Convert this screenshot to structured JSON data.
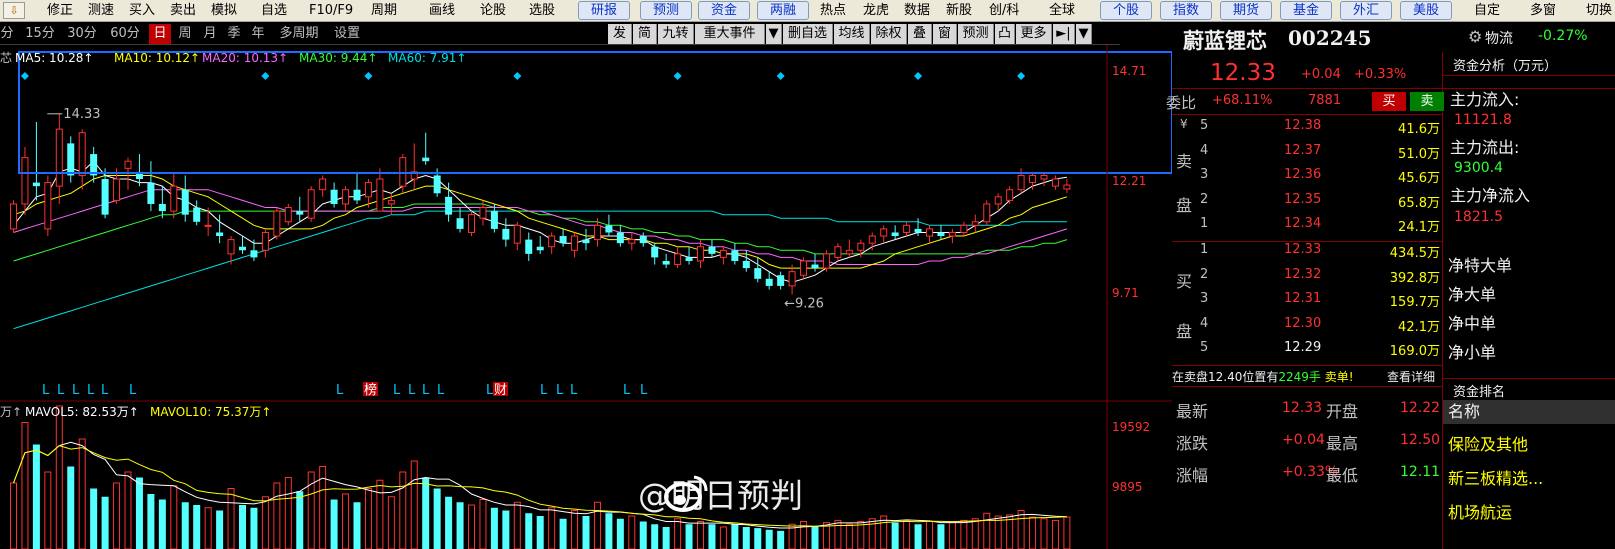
{
  "topbar": {
    "items": [
      "修正",
      "测速",
      "买入",
      "卖出",
      "模拟",
      "自选",
      "F10/F9",
      "周期",
      "画线",
      "论股",
      "选股"
    ],
    "buttons": [
      "研报",
      "预测",
      "资金",
      "两融"
    ],
    "items2": [
      "热点",
      "龙虎",
      "数据",
      "新股",
      "创/科",
      "全球"
    ],
    "buttons2": [
      "个股",
      "指数",
      "期货",
      "基金",
      "外汇",
      "美股"
    ],
    "items3": [
      "自定",
      "多窗",
      "切换"
    ]
  },
  "periods": [
    "分",
    "15分",
    "30分",
    "60分",
    "日",
    "周",
    "月",
    "季",
    "年",
    "多周期",
    "设置"
  ],
  "active_period": "日",
  "toolbar_right": [
    "发",
    "简",
    "九转",
    "重大事件",
    "▼",
    "删自选",
    "均线",
    "除权",
    "叠",
    "窗",
    "预测",
    "凸",
    "更多",
    "►|",
    "▼"
  ],
  "ma_labels": {
    "prefix": "芯",
    "ma5": "MA5: 10.28↑",
    "ma10": "MA10: 10.12↑",
    "ma20": "MA20: 10.13↑",
    "ma30": "MA30: 9.44↑",
    "ma60": "MA60: 7.91↑"
  },
  "vol_labels": {
    "prefix": "万↑",
    "mavol5": "MAVOL5: 82.53万↑",
    "mavol10": "MAVOL10: 75.37万↑"
  },
  "price_axis": [
    "14.71",
    "12.21",
    "9.71"
  ],
  "vol_axis": [
    "19592",
    "9895"
  ],
  "annotations": {
    "high": "14.33",
    "low": "←9.26"
  },
  "signal_row": [
    "L",
    "L",
    "L",
    "L",
    "L",
    "L",
    "L",
    "榜",
    "L",
    "L",
    "L",
    "L",
    "L",
    "财",
    "L",
    "L",
    "L",
    "L",
    "L"
  ],
  "watermark": "@明日预判",
  "colors": {
    "up": "#ff3030",
    "down": "#54ffff",
    "ma5": "#ffffff",
    "ma10": "#ffff00",
    "ma20": "#ff66ff",
    "ma30": "#33ff33",
    "ma60": "#00e0e0",
    "box": "#1e6cff"
  },
  "chart_data": {
    "type": "candlestick",
    "ylim": [
      7.0,
      15.7
    ],
    "ohlc": [
      [
        11.1,
        11.9,
        11.0,
        11.8
      ],
      [
        11.8,
        13.4,
        11.5,
        13.1
      ],
      [
        12.4,
        14.1,
        11.9,
        12.3
      ],
      [
        11.1,
        12.6,
        10.9,
        12.4
      ],
      [
        12.3,
        14.33,
        11.8,
        13.9
      ],
      [
        13.5,
        13.7,
        12.4,
        12.6
      ],
      [
        12.6,
        13.9,
        12.2,
        13.8
      ],
      [
        13.2,
        13.4,
        12.4,
        12.6
      ],
      [
        12.5,
        12.8,
        11.4,
        11.5
      ],
      [
        11.9,
        12.8,
        11.8,
        12.5
      ],
      [
        12.8,
        13.1,
        12.2,
        13.0
      ],
      [
        12.7,
        13.2,
        12.3,
        12.5
      ],
      [
        12.4,
        13.0,
        11.6,
        11.8
      ],
      [
        11.8,
        12.3,
        11.4,
        11.6
      ],
      [
        11.6,
        12.7,
        11.4,
        12.3
      ],
      [
        12.2,
        12.6,
        11.3,
        11.5
      ],
      [
        11.7,
        11.9,
        11.2,
        11.3
      ],
      [
        11.2,
        11.7,
        10.9,
        11.2
      ],
      [
        11.0,
        11.5,
        10.7,
        10.9
      ],
      [
        10.4,
        10.9,
        10.1,
        10.8
      ],
      [
        10.6,
        10.9,
        10.4,
        10.5
      ],
      [
        10.5,
        10.8,
        10.2,
        10.3
      ],
      [
        10.5,
        11.1,
        10.3,
        11.0
      ],
      [
        10.9,
        11.7,
        10.8,
        11.6
      ],
      [
        11.3,
        11.8,
        11.2,
        11.7
      ],
      [
        11.6,
        12.0,
        11.3,
        11.5
      ],
      [
        11.4,
        12.3,
        11.3,
        12.2
      ],
      [
        12.2,
        12.6,
        12.0,
        12.5
      ],
      [
        12.2,
        12.4,
        11.7,
        11.8
      ],
      [
        11.8,
        12.3,
        11.6,
        12.2
      ],
      [
        12.2,
        12.7,
        11.8,
        11.9
      ],
      [
        12.0,
        12.5,
        11.7,
        12.4
      ],
      [
        11.6,
        12.8,
        11.6,
        12.5
      ],
      [
        11.8,
        12.1,
        11.5,
        11.9
      ],
      [
        12.3,
        13.2,
        12.1,
        13.1
      ],
      [
        12.5,
        13.5,
        12.2,
        12.7
      ],
      [
        13.1,
        13.8,
        12.9,
        13.0
      ],
      [
        12.6,
        12.8,
        12.0,
        12.1
      ],
      [
        12.0,
        12.4,
        11.3,
        11.5
      ],
      [
        11.4,
        11.7,
        11.0,
        11.1
      ],
      [
        11.0,
        11.6,
        10.9,
        11.5
      ],
      [
        11.4,
        11.9,
        11.2,
        11.7
      ],
      [
        11.6,
        11.8,
        11.0,
        11.1
      ],
      [
        11.1,
        11.4,
        10.6,
        10.8
      ],
      [
        10.7,
        11.3,
        10.5,
        11.2
      ],
      [
        10.8,
        11.0,
        10.2,
        10.4
      ],
      [
        10.6,
        10.9,
        10.4,
        10.5
      ],
      [
        10.6,
        11.0,
        10.4,
        10.9
      ],
      [
        10.9,
        11.1,
        10.6,
        10.7
      ],
      [
        10.5,
        11.0,
        10.3,
        10.9
      ],
      [
        10.8,
        11.1,
        10.5,
        10.7
      ],
      [
        10.8,
        11.4,
        10.6,
        11.2
      ],
      [
        11.2,
        11.5,
        10.9,
        11.0
      ],
      [
        11.0,
        11.2,
        10.6,
        10.7
      ],
      [
        10.7,
        11.0,
        10.5,
        10.8
      ],
      [
        10.9,
        11.0,
        10.6,
        10.7
      ],
      [
        10.6,
        10.7,
        10.1,
        10.3
      ],
      [
        10.2,
        10.4,
        10.0,
        10.1
      ],
      [
        10.1,
        10.6,
        10.0,
        10.4
      ],
      [
        10.3,
        10.6,
        10.1,
        10.2
      ],
      [
        10.2,
        10.8,
        10.0,
        10.6
      ],
      [
        10.6,
        10.8,
        10.3,
        10.4
      ],
      [
        10.3,
        10.6,
        10.1,
        10.5
      ],
      [
        10.5,
        10.7,
        10.1,
        10.2
      ],
      [
        10.2,
        10.5,
        9.9,
        10.0
      ],
      [
        10.0,
        10.3,
        9.6,
        9.7
      ],
      [
        9.7,
        9.9,
        9.4,
        9.5
      ],
      [
        9.8,
        9.9,
        9.4,
        9.5
      ],
      [
        9.5,
        10.1,
        9.26,
        9.9
      ],
      [
        9.8,
        10.3,
        9.7,
        10.2
      ],
      [
        10.1,
        10.4,
        9.9,
        10.0
      ],
      [
        10.0,
        10.5,
        9.9,
        10.4
      ],
      [
        10.3,
        10.7,
        10.2,
        10.6
      ],
      [
        10.4,
        10.8,
        10.3,
        10.5
      ],
      [
        10.5,
        10.8,
        10.3,
        10.7
      ],
      [
        10.7,
        11.0,
        10.5,
        10.9
      ],
      [
        10.9,
        11.2,
        10.7,
        11.1
      ],
      [
        11.0,
        11.2,
        10.8,
        10.9
      ],
      [
        11.0,
        11.3,
        10.9,
        11.2
      ],
      [
        11.1,
        11.4,
        10.9,
        11.0
      ],
      [
        10.9,
        11.2,
        10.7,
        11.1
      ],
      [
        11.0,
        11.2,
        10.8,
        10.9
      ],
      [
        10.9,
        11.1,
        10.7,
        11.0
      ],
      [
        11.0,
        11.3,
        10.9,
        11.2
      ],
      [
        11.2,
        11.5,
        11.0,
        11.3
      ],
      [
        11.3,
        11.9,
        11.2,
        11.8
      ],
      [
        11.8,
        12.1,
        11.6,
        12.0
      ],
      [
        11.9,
        12.3,
        11.8,
        12.2
      ],
      [
        12.2,
        12.8,
        12.1,
        12.6
      ],
      [
        12.4,
        12.7,
        12.2,
        12.6
      ],
      [
        12.5,
        12.7,
        12.3,
        12.6
      ],
      [
        12.3,
        12.6,
        12.2,
        12.5
      ],
      [
        12.22,
        12.5,
        12.11,
        12.33
      ]
    ],
    "ma": {
      "ma5": [
        11.2,
        11.6,
        12.0,
        12.1,
        12.7,
        12.8,
        12.7,
        13.0,
        12.6,
        12.5,
        12.5,
        12.4,
        12.4,
        12.3,
        12.0,
        11.9,
        11.7,
        11.6,
        11.3,
        11.1,
        10.9,
        10.7,
        10.7,
        10.9,
        11.1,
        11.3,
        11.5,
        11.8,
        11.9,
        12.0,
        12.0,
        12.1,
        12.2,
        12.1,
        12.3,
        12.5,
        12.6,
        12.5,
        12.2,
        11.9,
        11.6,
        11.4,
        11.3,
        11.2,
        11.2,
        11.1,
        11.0,
        10.8,
        10.7,
        10.7,
        10.8,
        10.9,
        10.9,
        10.9,
        10.8,
        10.8,
        10.6,
        10.5,
        10.4,
        10.3,
        10.3,
        10.3,
        10.4,
        10.4,
        10.3,
        10.1,
        9.9,
        9.7,
        9.6,
        9.7,
        9.8,
        10.0,
        10.2,
        10.3,
        10.4,
        10.6,
        10.7,
        10.8,
        10.9,
        11.0,
        11.0,
        11.0,
        11.0,
        11.0,
        11.2,
        11.4,
        11.6,
        11.9,
        12.1,
        12.3,
        12.4,
        12.5,
        12.55
      ],
      "ma10": [
        11.5,
        11.6,
        11.8,
        11.9,
        12.0,
        12.1,
        12.3,
        12.5,
        12.6,
        12.6,
        12.6,
        12.6,
        12.6,
        12.5,
        12.3,
        12.2,
        12.1,
        12.0,
        11.8,
        11.6,
        11.4,
        11.2,
        11.1,
        11.1,
        11.1,
        11.1,
        11.1,
        11.2,
        11.4,
        11.5,
        11.7,
        11.8,
        11.9,
        12.0,
        12.1,
        12.2,
        12.3,
        12.3,
        12.2,
        12.1,
        12.0,
        11.9,
        11.8,
        11.7,
        11.6,
        11.4,
        11.3,
        11.2,
        11.1,
        11.0,
        10.9,
        10.9,
        10.8,
        10.8,
        10.8,
        10.8,
        10.7,
        10.7,
        10.6,
        10.6,
        10.5,
        10.5,
        10.4,
        10.4,
        10.4,
        10.3,
        10.1,
        10.0,
        10.0,
        10.0,
        10.0,
        10.0,
        10.0,
        10.0,
        10.0,
        10.1,
        10.2,
        10.4,
        10.5,
        10.6,
        10.7,
        10.8,
        10.9,
        10.9,
        11.0,
        11.1,
        11.2,
        11.4,
        11.5,
        11.7,
        11.8,
        11.9,
        12.0
      ],
      "ma20": [
        11.0,
        11.1,
        11.2,
        11.3,
        11.4,
        11.5,
        11.6,
        11.7,
        11.8,
        11.9,
        12.0,
        12.1,
        12.2,
        12.2,
        12.2,
        12.2,
        12.2,
        12.2,
        12.1,
        12.0,
        11.9,
        11.8,
        11.7,
        11.7,
        11.6,
        11.6,
        11.6,
        11.6,
        11.6,
        11.6,
        11.6,
        11.6,
        11.6,
        11.6,
        11.6,
        11.7,
        11.7,
        11.7,
        11.7,
        11.7,
        11.7,
        11.7,
        11.7,
        11.7,
        11.7,
        11.6,
        11.6,
        11.5,
        11.4,
        11.3,
        11.2,
        11.2,
        11.1,
        11.0,
        11.0,
        10.9,
        10.9,
        10.8,
        10.8,
        10.7,
        10.7,
        10.6,
        10.6,
        10.5,
        10.5,
        10.4,
        10.4,
        10.3,
        10.3,
        10.2,
        10.2,
        10.2,
        10.1,
        10.1,
        10.1,
        10.1,
        10.1,
        10.1,
        10.1,
        10.1,
        10.2,
        10.2,
        10.3,
        10.3,
        10.4,
        10.4,
        10.5,
        10.6,
        10.7,
        10.8,
        10.9,
        11.0,
        11.1
      ],
      "ma30": [
        10.2,
        10.3,
        10.4,
        10.5,
        10.6,
        10.7,
        10.8,
        10.9,
        11.0,
        11.1,
        11.2,
        11.3,
        11.4,
        11.5,
        11.5,
        11.6,
        11.6,
        11.6,
        11.6,
        11.6,
        11.6,
        11.6,
        11.6,
        11.6,
        11.6,
        11.6,
        11.6,
        11.6,
        11.6,
        11.6,
        11.6,
        11.6,
        11.7,
        11.7,
        11.7,
        11.8,
        11.8,
        11.8,
        11.8,
        11.8,
        11.8,
        11.8,
        11.7,
        11.7,
        11.6,
        11.6,
        11.5,
        11.5,
        11.4,
        11.4,
        11.3,
        11.3,
        11.2,
        11.2,
        11.1,
        11.1,
        11.0,
        11.0,
        10.9,
        10.9,
        10.8,
        10.8,
        10.8,
        10.7,
        10.7,
        10.6,
        10.6,
        10.5,
        10.5,
        10.5,
        10.4,
        10.4,
        10.4,
        10.4,
        10.4,
        10.4,
        10.4,
        10.4,
        10.4,
        10.4,
        10.4,
        10.4,
        10.4,
        10.4,
        10.4,
        10.5,
        10.5,
        10.5,
        10.6,
        10.6,
        10.7,
        10.7,
        10.8
      ],
      "ma60": [
        8.3,
        8.4,
        8.5,
        8.6,
        8.7,
        8.8,
        8.9,
        9.0,
        9.1,
        9.2,
        9.3,
        9.4,
        9.5,
        9.6,
        9.7,
        9.8,
        9.9,
        10.0,
        10.1,
        10.2,
        10.3,
        10.4,
        10.5,
        10.6,
        10.7,
        10.8,
        10.9,
        11.0,
        11.1,
        11.2,
        11.3,
        11.4,
        11.4,
        11.5,
        11.5,
        11.5,
        11.6,
        11.6,
        11.6,
        11.6,
        11.6,
        11.6,
        11.6,
        11.6,
        11.6,
        11.6,
        11.6,
        11.6,
        11.6,
        11.6,
        11.6,
        11.6,
        11.6,
        11.6,
        11.6,
        11.6,
        11.6,
        11.6,
        11.6,
        11.6,
        11.6,
        11.6,
        11.5,
        11.5,
        11.5,
        11.5,
        11.5,
        11.4,
        11.4,
        11.4,
        11.4,
        11.4,
        11.3,
        11.3,
        11.3,
        11.3,
        11.3,
        11.3,
        11.3,
        11.3,
        11.2,
        11.2,
        11.2,
        11.2,
        11.2,
        11.2,
        11.2,
        11.2,
        11.3,
        11.3,
        11.3,
        11.3,
        11.3
      ]
    },
    "volume": [
      120,
      230,
      190,
      140,
      260,
      150,
      200,
      110,
      95,
      120,
      140,
      130,
      100,
      90,
      115,
      85,
      80,
      75,
      70,
      110,
      80,
      75,
      95,
      120,
      130,
      105,
      140,
      150,
      90,
      100,
      85,
      110,
      125,
      95,
      140,
      160,
      130,
      110,
      95,
      85,
      80,
      90,
      75,
      70,
      85,
      65,
      60,
      75,
      55,
      70,
      60,
      85,
      65,
      55,
      60,
      50,
      45,
      40,
      55,
      45,
      50,
      45,
      40,
      45,
      40,
      38,
      35,
      33,
      45,
      50,
      42,
      48,
      52,
      45,
      50,
      55,
      60,
      48,
      52,
      45,
      50,
      45,
      48,
      52,
      55,
      65,
      60,
      62,
      70,
      58,
      55,
      52,
      58
    ],
    "volume_axis_max": 19592
  },
  "stock": {
    "name": "蔚蓝锂芯",
    "code": "002245",
    "price": "12.33",
    "change": "+0.04",
    "pct": "+0.33%",
    "gear": "⚙",
    "sector": "物流",
    "sector_pct": "-0.27%"
  },
  "weibi": {
    "label": "委比",
    "value": "+68.11%",
    "diff": "7881",
    "buy_btn": "买",
    "sell_btn": "卖"
  },
  "sell_side": {
    "label1": "¥",
    "label2": "卖",
    "label3": "盘",
    "rows": [
      [
        "5",
        "12.38",
        "41.6万"
      ],
      [
        "4",
        "12.37",
        "51.0万"
      ],
      [
        "3",
        "12.36",
        "45.6万"
      ],
      [
        "2",
        "12.35",
        "65.8万"
      ],
      [
        "1",
        "12.34",
        "24.1万"
      ]
    ]
  },
  "buy_side": {
    "label1": "买",
    "label2": "盘",
    "rows": [
      [
        "1",
        "12.33",
        "434.5万"
      ],
      [
        "2",
        "12.32",
        "392.8万"
      ],
      [
        "3",
        "12.31",
        "159.7万"
      ],
      [
        "4",
        "12.30",
        "42.1万"
      ],
      [
        "5",
        "12.29",
        "169.0万"
      ]
    ]
  },
  "notice": {
    "text_pre": "在卖盘12.40位置有",
    "text_num": "2249手",
    "text_post": "卖单!",
    "link": "查看详细"
  },
  "quote": {
    "rows": [
      [
        "最新",
        "12.33",
        "开盘",
        "12.22"
      ],
      [
        "涨跌",
        "+0.04",
        "最高",
        "12.50"
      ],
      [
        "涨幅",
        "+0.33%",
        "最低",
        "12.11"
      ]
    ]
  },
  "fund": {
    "title": "资金分析（万元）",
    "inflow_label": "主力流入:",
    "inflow": "11121.8",
    "outflow_label": "主力流出:",
    "outflow": "9300.4",
    "net_label": "主力净流入",
    "net": "1821.5",
    "breakdown": [
      "净特大单",
      "净大单",
      "净中单",
      "净小单"
    ]
  },
  "rank": {
    "title": "资金排名",
    "header": "名称",
    "items": [
      "保险及其他",
      "新三板精选...",
      "机场航运"
    ]
  }
}
